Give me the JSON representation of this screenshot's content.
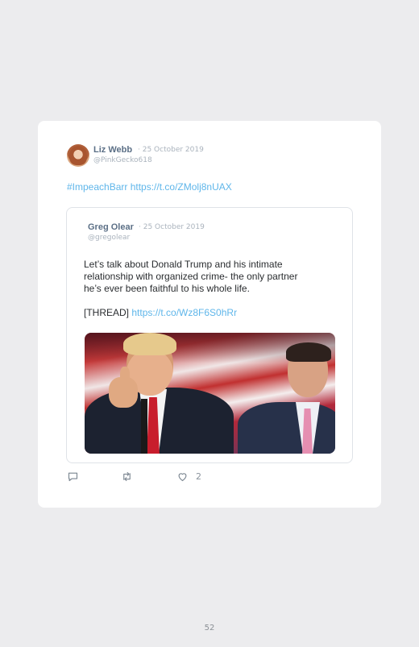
{
  "tweet": {
    "author_name": "Liz Webb",
    "date": "· 25 October 2019",
    "handle": "@PinkGecko618",
    "text": "#ImpeachBarr https://t.co/ZMolj8nUAX"
  },
  "quoted_tweet": {
    "author_name": "Greg Olear",
    "date": "· 25 October 2019",
    "handle": "@gregolear",
    "body": "Let’s talk about Donald Trump and his intimate\nrelationship with organized crime-  the only partner\nhe’s ever been faithful to his whole life.",
    "thread_label": "[THREAD]",
    "thread_link": "https://t.co/Wz8F6S0hRr"
  },
  "actions": {
    "like_count": "2"
  },
  "icons": [
    "reply-icon",
    "retweet-icon",
    "like-icon"
  ],
  "colors": {
    "link": "#5fb6ea",
    "name": "#5b6f86",
    "meta": "#aab3bd"
  },
  "page_number": "52"
}
